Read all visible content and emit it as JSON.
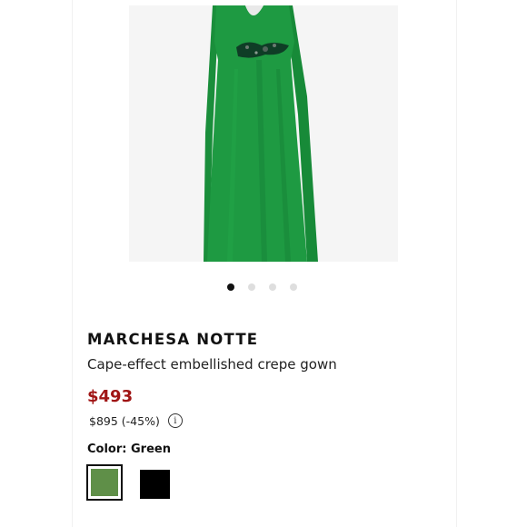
{
  "product": {
    "brand": "MARCHESA NOTTE",
    "name": "Cape-effect embellished crepe gown",
    "sale_price": "$493",
    "original_price": "$895 (-45%)",
    "info_icon": "info-icon",
    "info_glyph": "i"
  },
  "gallery": {
    "dots": 4,
    "active_index": 0,
    "dress_color": "#1e9a42",
    "embellishment_color": "#0f3d26"
  },
  "color_selector": {
    "label": "Color:",
    "selected": "Green",
    "swatches": [
      {
        "name": "Green",
        "hex": "#5f8f48"
      },
      {
        "name": "Black",
        "hex": "#000000"
      }
    ]
  },
  "colors": {
    "sale_price": "#a01515"
  }
}
